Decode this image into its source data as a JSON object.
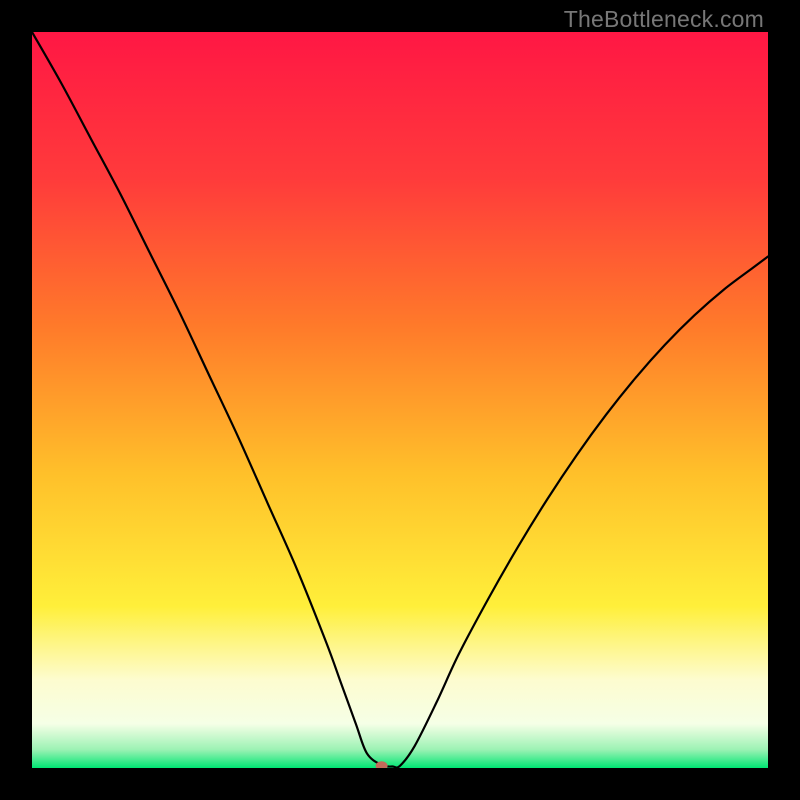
{
  "watermark": "TheBottleneck.com",
  "chart_data": {
    "type": "line",
    "title": "",
    "xlabel": "",
    "ylabel": "",
    "xlim": [
      0,
      100
    ],
    "ylim": [
      0,
      100
    ],
    "grid": false,
    "legend": false,
    "background_gradient_stops": [
      {
        "offset": 0.0,
        "color": "#ff1744"
      },
      {
        "offset": 0.2,
        "color": "#ff3b3b"
      },
      {
        "offset": 0.4,
        "color": "#ff7a2a"
      },
      {
        "offset": 0.6,
        "color": "#ffc02a"
      },
      {
        "offset": 0.78,
        "color": "#ffef3a"
      },
      {
        "offset": 0.88,
        "color": "#fdfccf"
      },
      {
        "offset": 0.94,
        "color": "#f5ffe6"
      },
      {
        "offset": 0.975,
        "color": "#9cf2b4"
      },
      {
        "offset": 1.0,
        "color": "#00e673"
      }
    ],
    "series": [
      {
        "name": "curve",
        "color": "#000000",
        "width": 2.2,
        "x": [
          0,
          4,
          8,
          12,
          16,
          20,
          24,
          28,
          32,
          36,
          40,
          42,
          44,
          45.5,
          47.5,
          49,
          50,
          52,
          55,
          58,
          62,
          66,
          70,
          74,
          78,
          82,
          86,
          90,
          94,
          98,
          100
        ],
        "y": [
          100,
          93,
          85.5,
          78,
          70,
          62,
          53.5,
          45,
          36,
          27,
          17,
          11.5,
          6,
          2,
          0.4,
          0.2,
          0.3,
          3,
          9,
          15.5,
          23,
          30,
          36.5,
          42.5,
          48,
          53,
          57.5,
          61.5,
          65,
          68,
          69.5
        ]
      }
    ],
    "marker": {
      "name": "min-marker",
      "x": 47.5,
      "y": 0.3,
      "rx": 6,
      "ry": 4.5,
      "fill": "#c26a5a"
    }
  }
}
